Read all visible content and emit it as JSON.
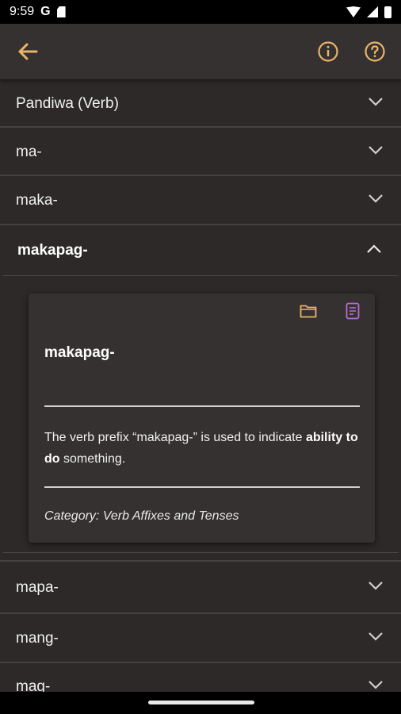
{
  "status": {
    "time": "9:59",
    "g": "G"
  },
  "accent": "#e9b46a",
  "rows_top": [
    {
      "label": "Pandiwa (Verb)"
    },
    {
      "label": "ma-"
    },
    {
      "label": "maka-"
    }
  ],
  "expanded": {
    "label": "makapag-",
    "card": {
      "title": "makapag-",
      "desc_pre": "The verb prefix “makapag-” is used to indicate ",
      "desc_bold": "ability to do",
      "desc_post": " something.",
      "category": "Category: Verb Affixes and Tenses"
    }
  },
  "rows_bottom": [
    {
      "label": "mapa-"
    },
    {
      "label": "mang-"
    },
    {
      "label": "mag-"
    }
  ],
  "icons": {
    "back": "arrow-back-icon",
    "info": "info-icon",
    "help": "help-icon",
    "folder": "folder-icon",
    "note": "note-icon",
    "chevron": "chevron-down-icon"
  }
}
